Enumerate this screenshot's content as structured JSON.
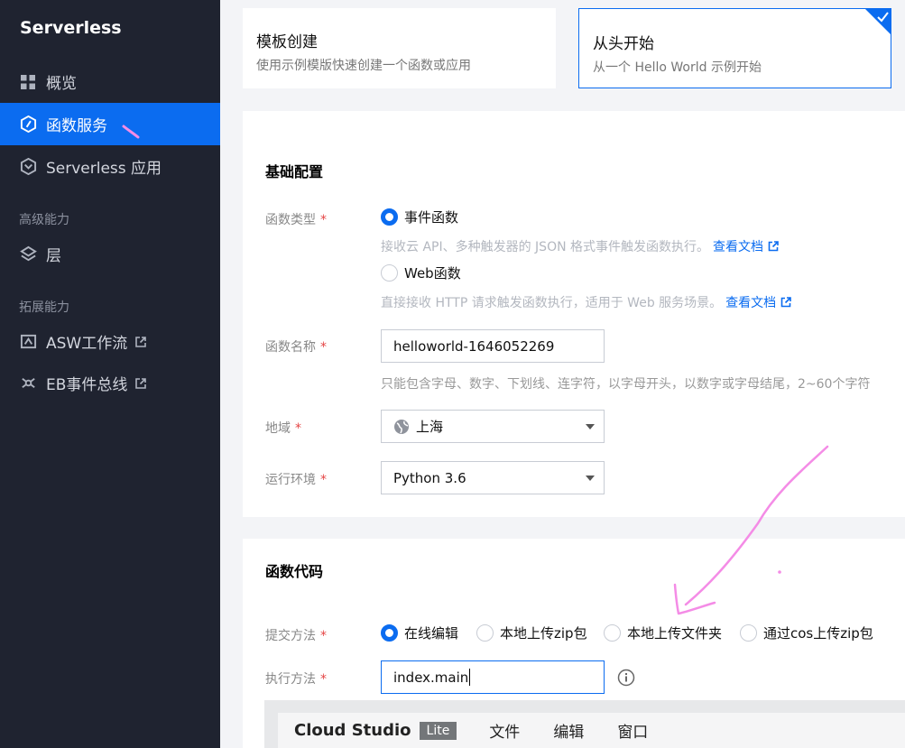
{
  "sidebar": {
    "brand": "Serverless",
    "items": [
      {
        "label": "概览",
        "icon": "grid-icon"
      },
      {
        "label": "函数服务",
        "icon": "function-icon",
        "active": true
      },
      {
        "label": "Serverless 应用",
        "icon": "app-icon"
      }
    ],
    "groups": {
      "advanced": {
        "title": "高级能力",
        "items": [
          {
            "label": "层",
            "icon": "layers-icon"
          }
        ]
      },
      "extended": {
        "title": "拓展能力",
        "items": [
          {
            "label": "ASW工作流",
            "icon": "workflow-icon",
            "external": true
          },
          {
            "label": "EB事件总线",
            "icon": "eventbus-icon",
            "external": true
          }
        ]
      }
    }
  },
  "templates": {
    "template_create": {
      "title": "模板创建",
      "desc": "使用示例模版快速创建一个函数或应用"
    },
    "from_scratch": {
      "title": "从头开始",
      "desc": "从一个 Hello World 示例开始",
      "selected": true
    }
  },
  "basic": {
    "title": "基础配置",
    "func_type": {
      "label": "函数类型",
      "options": [
        {
          "label": "事件函数",
          "selected": true,
          "hint": "接收云 API、多种触发器的 JSON 格式事件触发函数执行。",
          "link": "查看文档"
        },
        {
          "label": "Web函数",
          "selected": false,
          "hint": "直接接收 HTTP 请求触发函数执行，适用于 Web 服务场景。",
          "link": "查看文档"
        }
      ]
    },
    "func_name": {
      "label": "函数名称",
      "value": "helloworld-1646052269",
      "hint": "只能包含字母、数字、下划线、连字符，以字母开头，以数字或字母结尾，2~60个字符"
    },
    "region": {
      "label": "地域",
      "value": "上海"
    },
    "runtime": {
      "label": "运行环境",
      "value": "Python 3.6"
    }
  },
  "code": {
    "title": "函数代码",
    "submit": {
      "label": "提交方法",
      "options": [
        {
          "label": "在线编辑",
          "selected": true
        },
        {
          "label": "本地上传zip包",
          "selected": false
        },
        {
          "label": "本地上传文件夹",
          "selected": false
        },
        {
          "label": "通过cos上传zip包",
          "selected": false
        }
      ]
    },
    "handler": {
      "label": "执行方法",
      "value": "index.main"
    }
  },
  "studio": {
    "brand": "Cloud Studio",
    "badge": "Lite",
    "menu": [
      "文件",
      "编辑",
      "窗口"
    ]
  },
  "required_mark": "*",
  "colors": {
    "accent": "#0b6cf0",
    "sidebar_bg": "#1f2330",
    "annotation": "#f48ce6"
  }
}
